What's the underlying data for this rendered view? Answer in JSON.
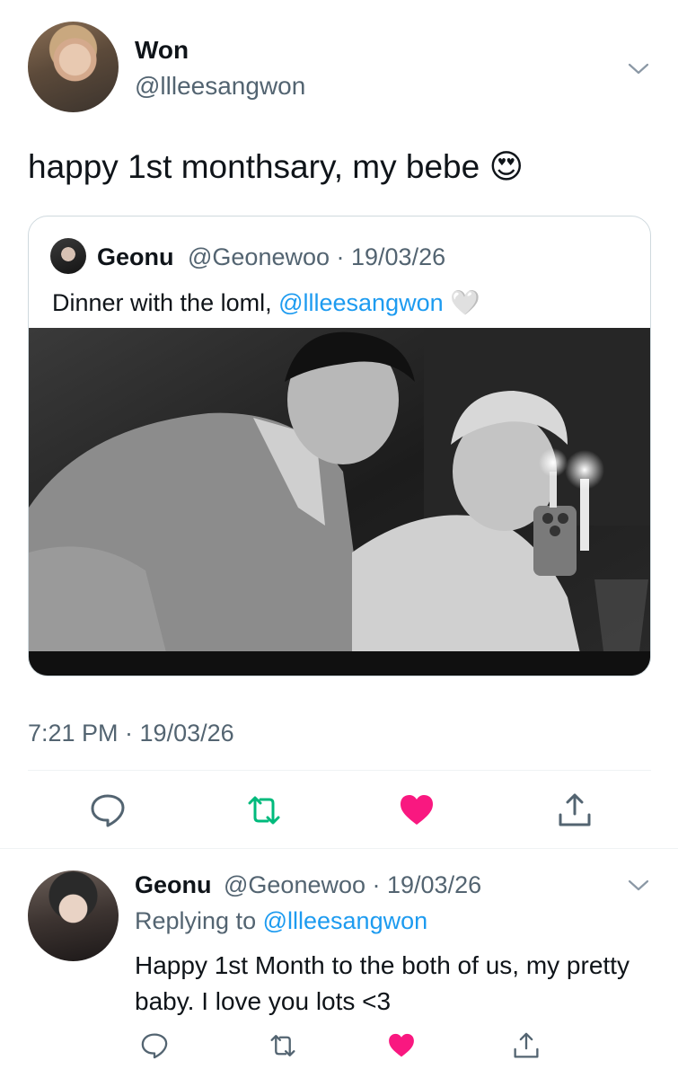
{
  "tweet": {
    "author_name": "Won",
    "author_handle": "@llleesangwon",
    "text": "happy 1st monthsary, my bebe 😍",
    "timestamp": "7:21 PM · 19/03/26"
  },
  "quoted": {
    "author_name": "Geonu",
    "meta": "@Geonewoo · 19/03/26",
    "text_prefix": "Dinner with the loml, ",
    "mention": "@llleesangwon",
    "emoji": "🤍"
  },
  "reply": {
    "author_name": "Geonu",
    "meta": "@Geonewoo · 19/03/26",
    "replying_prefix": "Replying to ",
    "replying_mention": "@llleesangwon",
    "text": "Happy 1st Month to the both of us, my pretty baby. I love you lots <3"
  },
  "icons": {
    "reply": "speech-bubble-icon",
    "retweet": "retweet-icon",
    "like": "heart-icon",
    "share": "share-icon",
    "more": "chevron-down-icon"
  },
  "colors": {
    "text": "#0f1419",
    "secondary": "#536471",
    "link": "#1d9bf0",
    "retweet_active": "#00ba7c",
    "like_active": "#f91880",
    "border": "#cfd9de"
  }
}
